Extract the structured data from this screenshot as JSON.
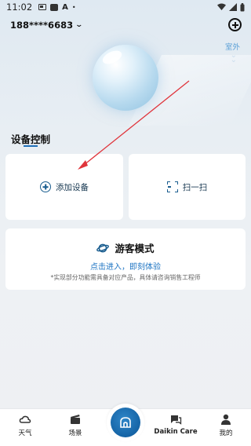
{
  "status_bar": {
    "time": "11:02",
    "letter_icon": "A"
  },
  "header": {
    "account": "188****6683",
    "outdoor_label": "室外"
  },
  "section": {
    "title": "设备控制"
  },
  "cards": {
    "add_device": "添加设备",
    "scan": "扫一扫",
    "guest": {
      "title": "游客模式",
      "link": "点击进入，即刻体验",
      "note": "*实现部分功能需具备对应产品，具体请咨询销售工程师"
    }
  },
  "tabs": [
    {
      "label": "天气",
      "icon": "weather-cloud-icon"
    },
    {
      "label": "场景",
      "icon": "scene-clapper-icon"
    },
    {
      "label": "",
      "icon": "daikin-home-icon"
    },
    {
      "label": "Daikin Care",
      "icon": "care-chat-icon"
    },
    {
      "label": "我的",
      "icon": "profile-person-icon"
    }
  ],
  "colors": {
    "accent": "#1d74c3",
    "annotation_arrow": "#e0343b",
    "card_bg": "#ffffff",
    "background": "#e8eef3"
  }
}
